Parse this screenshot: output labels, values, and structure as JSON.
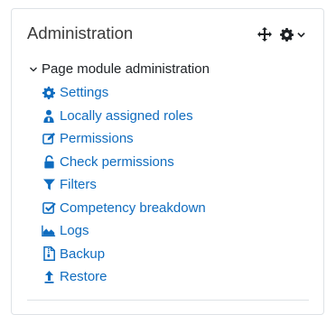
{
  "block": {
    "title": "Administration",
    "controls": {
      "move_icon": "move-icon",
      "gear_icon": "gear-icon",
      "caret_icon": "chevron-down-icon"
    }
  },
  "tree": {
    "parent_label": "Page module administration",
    "items": [
      {
        "label": "Settings",
        "icon": "gear-icon"
      },
      {
        "label": "Locally assigned roles",
        "icon": "user-role-icon"
      },
      {
        "label": "Permissions",
        "icon": "edit-icon"
      },
      {
        "label": "Check permissions",
        "icon": "unlock-icon"
      },
      {
        "label": "Filters",
        "icon": "filter-icon"
      },
      {
        "label": "Competency breakdown",
        "icon": "checkbox-icon"
      },
      {
        "label": "Logs",
        "icon": "area-chart-icon"
      },
      {
        "label": "Backup",
        "icon": "file-archive-icon"
      },
      {
        "label": "Restore",
        "icon": "upload-arrow-icon"
      }
    ]
  },
  "colors": {
    "link": "#0f6cbf",
    "text": "#1d2125",
    "border": "#dee2e6"
  }
}
